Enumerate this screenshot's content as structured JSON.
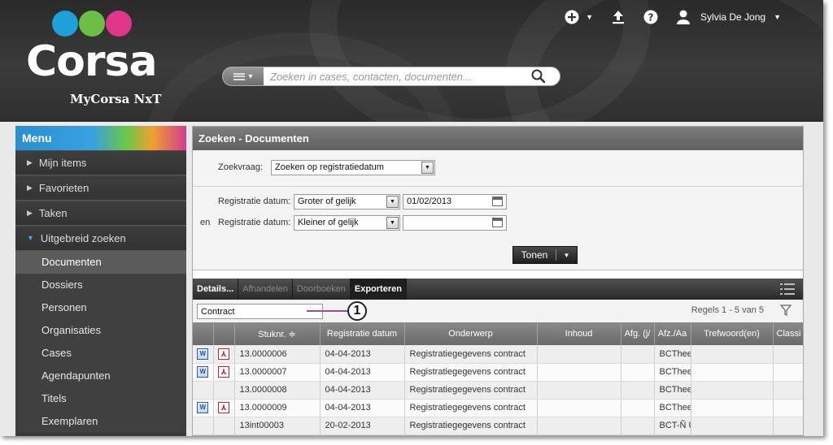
{
  "brand": {
    "name": "Corsa",
    "subtitle": "MyCorsa NxT",
    "circle_colors": [
      "#1fa0d8",
      "#6dbe45",
      "#e0368a"
    ]
  },
  "search": {
    "placeholder": "Zoeken in cases, contacten, documenten..."
  },
  "topbar": {
    "user_name": "Sylvia De Jong",
    "icons": [
      "add-icon",
      "upload-icon",
      "help-icon",
      "user-icon"
    ]
  },
  "menu": {
    "title": "Menu",
    "items": [
      {
        "label": "Mijn items"
      },
      {
        "label": "Favorieten"
      },
      {
        "label": "Taken"
      },
      {
        "label": "Uitgebreid zoeken"
      }
    ],
    "sub_items": [
      {
        "label": "Documenten",
        "active": true
      },
      {
        "label": "Dossiers"
      },
      {
        "label": "Personen"
      },
      {
        "label": "Organisaties"
      },
      {
        "label": "Cases"
      },
      {
        "label": "Agendapunten"
      },
      {
        "label": "Titels"
      },
      {
        "label": "Exemplaren"
      }
    ]
  },
  "main": {
    "title": "Zoeken - Documenten",
    "form": {
      "query_label": "Zoekvraag:",
      "query_value": "Zoeken op registratiedatum",
      "row1": {
        "prefix": "",
        "label": "Registratie datum:",
        "operator": "Groter of gelijk",
        "date": "01/02/2013"
      },
      "row2": {
        "prefix": "en",
        "label": "Registratie datum:",
        "operator": "Kleiner of gelijk",
        "date": ""
      },
      "submit_label": "Tonen"
    },
    "toolbar": {
      "details": "Details...",
      "afhandelen": "Afhandelen",
      "doorboeken": "Doorboeken",
      "exporteren": "Exporteren"
    },
    "filter": {
      "value": "Contract",
      "callout": "1",
      "rows_info": "Regels 1 - 5 van 5"
    },
    "table": {
      "headers": [
        "",
        "",
        "Stuknr. ≑",
        "Registratie datum",
        "Onderwerp",
        "Inhoud",
        "Afg. (j/",
        "Afz./Aa",
        "Trefwoord(en)",
        "Classi"
      ],
      "rows": [
        {
          "word": true,
          "pdf": true,
          "stuknr": "13.0000006",
          "datum": "04-04-2013",
          "onderwerp": "Registratiegegevens contract",
          "inhoud": "",
          "afg": "",
          "afz": "BCThee",
          "trefwoord": "",
          "classi": ""
        },
        {
          "word": true,
          "pdf": true,
          "stuknr": "13.0000007",
          "datum": "04-04-2013",
          "onderwerp": "Registratiegegevens contract",
          "inhoud": "",
          "afg": "",
          "afz": "BCThee",
          "trefwoord": "",
          "classi": ""
        },
        {
          "word": false,
          "pdf": false,
          "stuknr": "13.0000008",
          "datum": "04-04-2013",
          "onderwerp": "Registratiegegevens contract",
          "inhoud": "",
          "afg": "",
          "afz": "BCThee",
          "trefwoord": "",
          "classi": ""
        },
        {
          "word": true,
          "pdf": true,
          "stuknr": "13.0000009",
          "datum": "04-04-2013",
          "onderwerp": "Registratiegegevens contract",
          "inhoud": "",
          "afg": "",
          "afz": "BCThee",
          "trefwoord": "",
          "classi": ""
        },
        {
          "word": false,
          "pdf": false,
          "stuknr": "13int00003",
          "datum": "20-02-2013",
          "onderwerp": "Registratiegegevens contract",
          "inhoud": "",
          "afg": "",
          "afz": "BCT-Ñ Ü",
          "trefwoord": "",
          "classi": ""
        }
      ]
    }
  }
}
